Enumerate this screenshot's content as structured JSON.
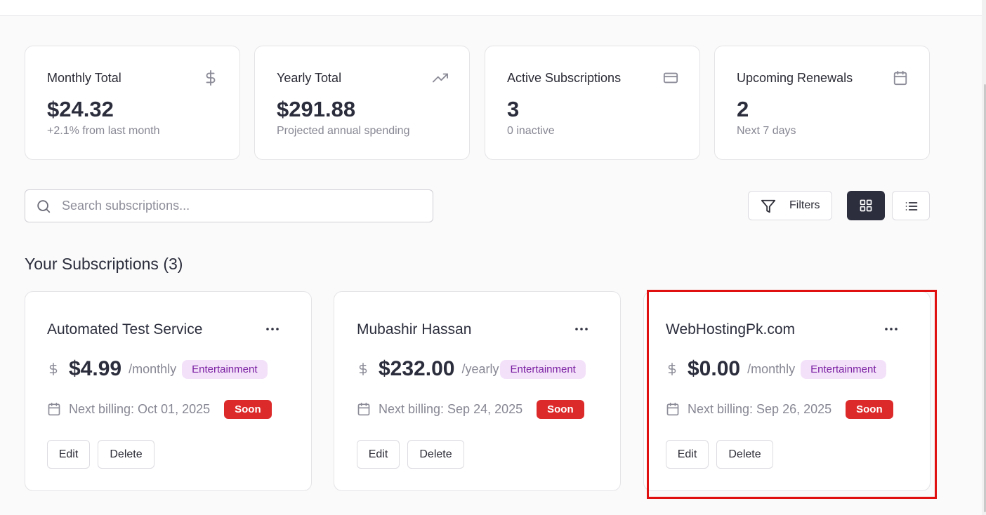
{
  "stats": [
    {
      "label": "Monthly Total",
      "value": "$24.32",
      "sub": "+2.1% from last month",
      "icon": "dollar-icon"
    },
    {
      "label": "Yearly Total",
      "value": "$291.88",
      "sub": "Projected annual spending",
      "icon": "trending-up-icon"
    },
    {
      "label": "Active Subscriptions",
      "value": "3",
      "sub": "0 inactive",
      "icon": "credit-card-icon"
    },
    {
      "label": "Upcoming Renewals",
      "value": "2",
      "sub": "Next 7 days",
      "icon": "calendar-icon"
    }
  ],
  "search": {
    "placeholder": "Search subscriptions..."
  },
  "toolbar": {
    "filters_label": "Filters",
    "active_view": "grid"
  },
  "section": {
    "title": "Your Subscriptions (3)"
  },
  "subscriptions": [
    {
      "name": "Automated Test Service",
      "price": "$4.99",
      "period": "/monthly",
      "category": "Entertainment",
      "billing": "Next billing: Oct 01, 2025",
      "badge": "Soon",
      "edit": "Edit",
      "delete": "Delete"
    },
    {
      "name": "Mubashir Hassan",
      "price": "$232.00",
      "period": "/yearly",
      "category": "Entertainment",
      "billing": "Next billing: Sep 24, 2025",
      "badge": "Soon",
      "edit": "Edit",
      "delete": "Delete"
    },
    {
      "name": "WebHostingPk.com",
      "price": "$0.00",
      "period": "/monthly",
      "category": "Entertainment",
      "billing": "Next billing: Sep 26, 2025",
      "badge": "Soon",
      "edit": "Edit",
      "delete": "Delete"
    }
  ],
  "colors": {
    "accent_dark": "#2c2e3e",
    "badge_red": "#dc2a2a",
    "category_bg": "#f3e1f9",
    "category_text": "#7a1fa2",
    "highlight": "#e01010"
  }
}
